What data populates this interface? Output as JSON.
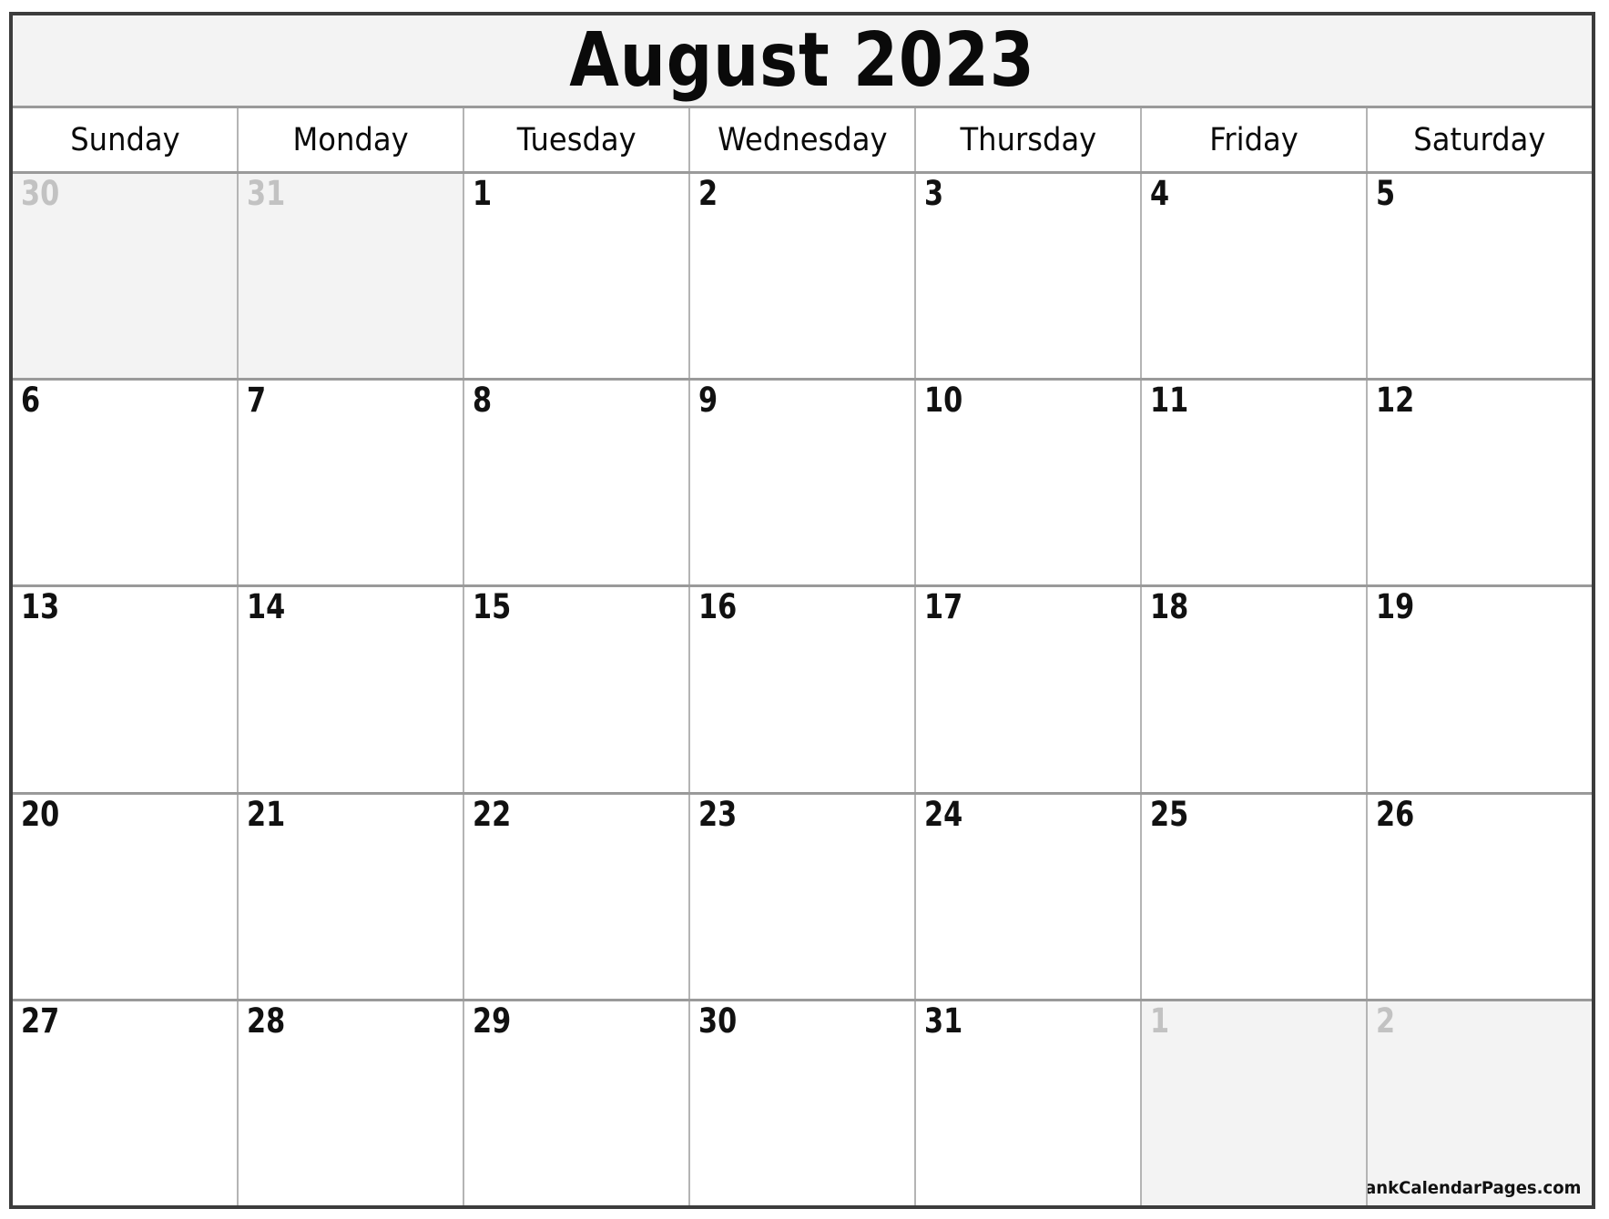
{
  "calendar": {
    "title": "August 2023",
    "month": "August",
    "year": "2023",
    "credit": "© BlankCalendarPages.com",
    "colors": {
      "frame": "#3c3c3c",
      "grid_line": "#b4b4b4",
      "row_line": "#9a9a9a",
      "title_band_bg": "#f3f3f3",
      "outside_cell_bg": "#f3f3f3",
      "outside_day_text": "#c2c2c2",
      "day_text": "#111111"
    },
    "weekdays": [
      {
        "label": "Sunday"
      },
      {
        "label": "Monday"
      },
      {
        "label": "Tuesday"
      },
      {
        "label": "Wednesday"
      },
      {
        "label": "Thursday"
      },
      {
        "label": "Friday"
      },
      {
        "label": "Saturday"
      }
    ],
    "weeks": [
      [
        {
          "day": "30",
          "outside": true
        },
        {
          "day": "31",
          "outside": true
        },
        {
          "day": "1",
          "outside": false
        },
        {
          "day": "2",
          "outside": false
        },
        {
          "day": "3",
          "outside": false
        },
        {
          "day": "4",
          "outside": false
        },
        {
          "day": "5",
          "outside": false
        }
      ],
      [
        {
          "day": "6",
          "outside": false
        },
        {
          "day": "7",
          "outside": false
        },
        {
          "day": "8",
          "outside": false
        },
        {
          "day": "9",
          "outside": false
        },
        {
          "day": "10",
          "outside": false
        },
        {
          "day": "11",
          "outside": false
        },
        {
          "day": "12",
          "outside": false
        }
      ],
      [
        {
          "day": "13",
          "outside": false
        },
        {
          "day": "14",
          "outside": false
        },
        {
          "day": "15",
          "outside": false
        },
        {
          "day": "16",
          "outside": false
        },
        {
          "day": "17",
          "outside": false
        },
        {
          "day": "18",
          "outside": false
        },
        {
          "day": "19",
          "outside": false
        }
      ],
      [
        {
          "day": "20",
          "outside": false
        },
        {
          "day": "21",
          "outside": false
        },
        {
          "day": "22",
          "outside": false
        },
        {
          "day": "23",
          "outside": false
        },
        {
          "day": "24",
          "outside": false
        },
        {
          "day": "25",
          "outside": false
        },
        {
          "day": "26",
          "outside": false
        }
      ],
      [
        {
          "day": "27",
          "outside": false
        },
        {
          "day": "28",
          "outside": false
        },
        {
          "day": "29",
          "outside": false
        },
        {
          "day": "30",
          "outside": false
        },
        {
          "day": "31",
          "outside": false
        },
        {
          "day": "1",
          "outside": true
        },
        {
          "day": "2",
          "outside": true
        }
      ]
    ]
  }
}
